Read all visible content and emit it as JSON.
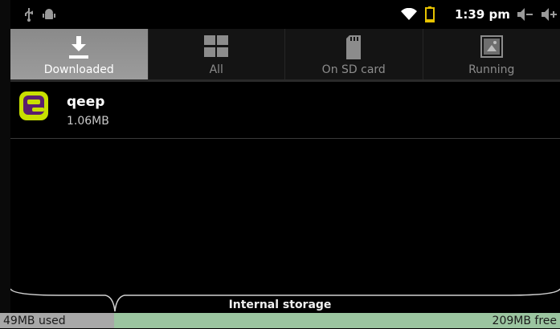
{
  "status_bar": {
    "time": "1:39 pm",
    "icons": [
      "usb-icon",
      "android-debug-icon",
      "wifi-icon",
      "battery-icon",
      "volume-down-icon",
      "volume-up-icon"
    ]
  },
  "tabs": [
    {
      "label": "Downloaded",
      "icon": "download-icon",
      "selected": true
    },
    {
      "label": "All",
      "icon": "grid-icon",
      "selected": false
    },
    {
      "label": "On SD card",
      "icon": "sd-card-icon",
      "selected": false
    },
    {
      "label": "Running",
      "icon": "running-apps-icon",
      "selected": false
    }
  ],
  "apps": [
    {
      "name": "qeep",
      "size": "1.06MB",
      "icon": "qeep-app-icon"
    }
  ],
  "storage": {
    "label": "Internal storage",
    "used": "49MB used",
    "free": "209MB free",
    "used_fraction": 0.19
  },
  "colors": {
    "selected_tab": "#9a9a9a",
    "used_bar": "#a8a8a8",
    "free_bar": "#9bc5a0",
    "qeep_accent": "#c8e000",
    "qeep_purple": "#5a1f6e"
  }
}
